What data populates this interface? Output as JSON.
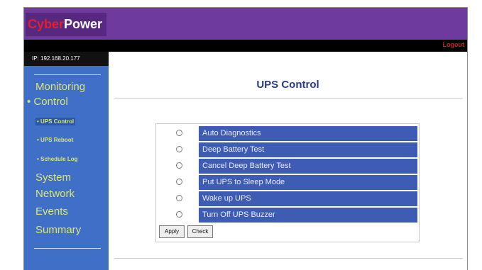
{
  "brand": {
    "cyber": "Cyber",
    "power": "Power"
  },
  "topbar": {
    "logout": "Logout"
  },
  "sidebar": {
    "ip": "IP: 192.168.20.177",
    "monitoring": "Monitoring",
    "control": "Control",
    "sub_items": [
      "• UPS Control",
      "• UPS Reboot",
      "• Schedule Log"
    ],
    "system": "System",
    "network": "Network",
    "events": "Events",
    "summary": "Summary"
  },
  "main": {
    "title": "UPS Control",
    "options": [
      "Auto Diagnostics",
      "Deep Battery Test",
      "Cancel Deep Battery Test",
      "Put UPS to Sleep Mode",
      "Wake up UPS",
      "Turn Off UPS Buzzer"
    ],
    "apply_label": "Apply",
    "check_label": "Check"
  },
  "colors": {
    "header": "#6f3a9e",
    "sidebar": "#3f6fc6",
    "option_row": "#3e5cb4",
    "menu_text": "#dce56e"
  }
}
